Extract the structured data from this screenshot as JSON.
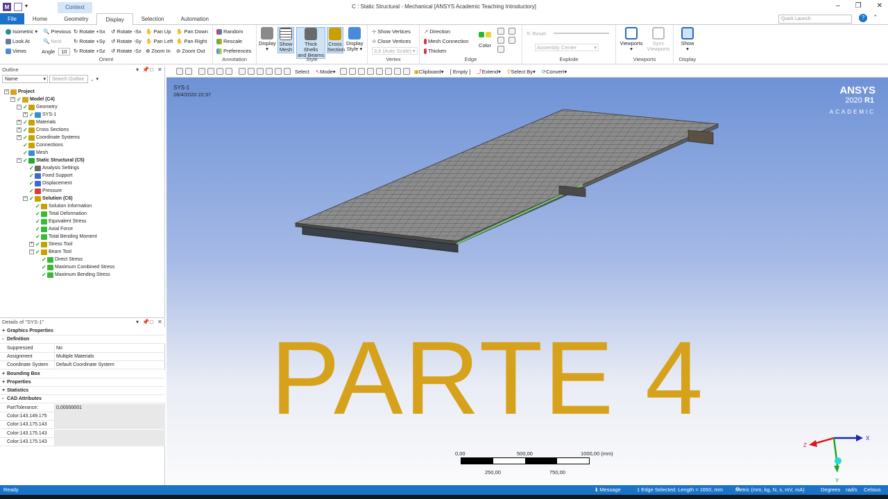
{
  "titlebar": {
    "context_tab": "Context",
    "window_title": "C : Static Structural - Mechanical [ANSYS Academic Teaching Introductory]",
    "controls": [
      "–",
      "❐",
      "✕"
    ]
  },
  "tabs": [
    "File",
    "Home",
    "Geometry",
    "Display",
    "Selection",
    "Automation"
  ],
  "active_tab": "Display",
  "quick_launch_placeholder": "Quick Launch",
  "ribbon": {
    "orient": {
      "label": "Orient",
      "isometric": "Isometric",
      "look_at": "Look At",
      "views": "Views",
      "previous": "Previous",
      "next": "Next",
      "angle_label": "Angle",
      "angle_value": "10",
      "rotate_px": "Rotate +Sx",
      "rotate_py": "Rotate +Sy",
      "rotate_pz": "Rotate +Sz",
      "rotate_mx": "Rotate -Sx",
      "rotate_my": "Rotate -Sy",
      "rotate_mz": "Rotate -Sz",
      "pan_up": "Pan Up",
      "pan_left": "Pan Left",
      "zoom_in": "Zoom In",
      "pan_down": "Pan Down",
      "pan_right": "Pan Right",
      "zoom_out": "Zoom Out"
    },
    "annotation": {
      "label": "Annotation",
      "random": "Random",
      "rescale": "Rescale",
      "preferences": "Preferences"
    },
    "style": {
      "label": "Style",
      "display": "Display",
      "show_mesh_1": "Show",
      "show_mesh_2": "Mesh",
      "thick_1": "Thick Shells",
      "thick_2": "and Beams",
      "cross_1": "Cross",
      "cross_2": "Section",
      "dstyle_1": "Display",
      "dstyle_2": "Style"
    },
    "vertex": {
      "label": "Vertex",
      "show_vertices": "Show Vertices",
      "close_vertices": "Close Vertices",
      "auto_scale": "3,6 (Auto Scale)"
    },
    "edge": {
      "label": "Edge",
      "direction": "Direction",
      "mesh_connection": "Mesh Connection",
      "thicken": "Thicken",
      "color": "Color"
    },
    "explode": {
      "label": "Explode",
      "reset": "Reset",
      "assembly_center": "Assembly Center"
    },
    "viewports": {
      "label": "Viewports",
      "viewports": "Viewports",
      "sync_1": "Sync",
      "sync_2": "Viewports"
    },
    "display": {
      "label": "Display",
      "show": "Show"
    }
  },
  "outline": {
    "title": "Outline",
    "name_field": "Name",
    "search_placeholder": "Search Outline",
    "tree": [
      {
        "label": "Project",
        "level": 0,
        "bold": true,
        "icon": "#d9a21b"
      },
      {
        "label": "Model (C4)",
        "level": 1,
        "bold": true,
        "icon": "#d9a21b"
      },
      {
        "label": "Geometry",
        "level": 2,
        "icon": "#c8a000"
      },
      {
        "label": "SYS-1",
        "level": 3,
        "icon": "#3a8ad8"
      },
      {
        "label": "Materials",
        "level": 2,
        "icon": "#c8a000"
      },
      {
        "label": "Cross Sections",
        "level": 2,
        "icon": "#c8a000"
      },
      {
        "label": "Coordinate Systems",
        "level": 2,
        "icon": "#c8a000"
      },
      {
        "label": "Connections",
        "level": 2,
        "icon": "#c8a000"
      },
      {
        "label": "Mesh",
        "level": 2,
        "icon": "#3a8ad8"
      },
      {
        "label": "Static Structural (C5)",
        "level": 2,
        "bold": true,
        "icon": "#2aa82a"
      },
      {
        "label": "Analysis Settings",
        "level": 3,
        "icon": "#6a6a6a"
      },
      {
        "label": "Fixed Support",
        "level": 3,
        "icon": "#3a6ad8"
      },
      {
        "label": "Displacement",
        "level": 3,
        "icon": "#3a6ad8"
      },
      {
        "label": "Pressure",
        "level": 3,
        "icon": "#d83a3a"
      },
      {
        "label": "Solution (C6)",
        "level": 3,
        "bold": true,
        "icon": "#c8a000"
      },
      {
        "label": "Solution Information",
        "level": 4,
        "icon": "#c8a000"
      },
      {
        "label": "Total Deformation",
        "level": 4,
        "icon": "#3ab83a"
      },
      {
        "label": "Equivalent Stress",
        "level": 4,
        "icon": "#3ab83a"
      },
      {
        "label": "Axial Force",
        "level": 4,
        "icon": "#3ab83a"
      },
      {
        "label": "Total Bending Moment",
        "level": 4,
        "icon": "#3ab83a"
      },
      {
        "label": "Stress Tool",
        "level": 4,
        "icon": "#c8a000"
      },
      {
        "label": "Beam Tool",
        "level": 4,
        "icon": "#c8a000"
      },
      {
        "label": "Direct Stress",
        "level": 5,
        "icon": "#3ab83a"
      },
      {
        "label": "Maximum Combined Stress",
        "level": 5,
        "icon": "#3ab83a"
      },
      {
        "label": "Maximum Bending Stress",
        "level": 5,
        "icon": "#3ab83a"
      }
    ]
  },
  "details": {
    "title": "Details of \"SYS-1\"",
    "rows": [
      {
        "type": "section",
        "sign": "+",
        "label": "Graphics Properties"
      },
      {
        "type": "section",
        "sign": "-",
        "label": "Definition"
      },
      {
        "type": "row",
        "key": "Suppressed",
        "value": "No"
      },
      {
        "type": "row",
        "key": "Assignment",
        "value": "Multiple Materials"
      },
      {
        "type": "row",
        "key": "Coordinate System",
        "value": "Default Coordinate System"
      },
      {
        "type": "section",
        "sign": "+",
        "label": "Bounding Box"
      },
      {
        "type": "section",
        "sign": "+",
        "label": "Properties"
      },
      {
        "type": "section",
        "sign": "+",
        "label": "Statistics"
      },
      {
        "type": "section",
        "sign": "-",
        "label": "CAD Attributes"
      },
      {
        "type": "grey",
        "key": "PartTolerance:",
        "value": "0,00000001"
      },
      {
        "type": "grey",
        "key": "Color:143.149.175",
        "value": ""
      },
      {
        "type": "grey",
        "key": "Color:143.175.143",
        "value": ""
      },
      {
        "type": "grey",
        "key": "Color:143.175.143",
        "value": ""
      },
      {
        "type": "grey",
        "key": "Color:143.175.143",
        "value": ""
      }
    ]
  },
  "viewport_toolbar": {
    "select": "Select",
    "mode": "Mode",
    "clipboard": "Clipboard",
    "empty": "[ Empty ]",
    "extend": "Extend",
    "select_by": "Select By",
    "convert": "Convert"
  },
  "viewport": {
    "sys_label": "SYS-1",
    "date": "28/4/2020 22:37",
    "logo": "ANSYS",
    "version_year": "2020",
    "version_r": "R1",
    "edition": "ACADEMIC",
    "overlay_text": "PARTE 4",
    "scale": {
      "top_labels": [
        "0,00",
        "500,00",
        "1000,00 (mm)"
      ],
      "bottom_labels": [
        "250,00",
        "750,00"
      ]
    },
    "triad": {
      "x": "X",
      "y": "Y",
      "z": "Z"
    }
  },
  "status": {
    "ready": "Ready",
    "messages": "1 Message",
    "selection": "1 Edge Selected: Length = 1650, mm",
    "units": "Metric (mm, kg, N, s, mV, mA)",
    "angle": "Degrees",
    "rate": "rad/s",
    "temp": "Celsius"
  },
  "colors": {
    "accent": "#1a73c8",
    "overlay": "#d7a21b",
    "viewport_top": "#6e92d6"
  }
}
